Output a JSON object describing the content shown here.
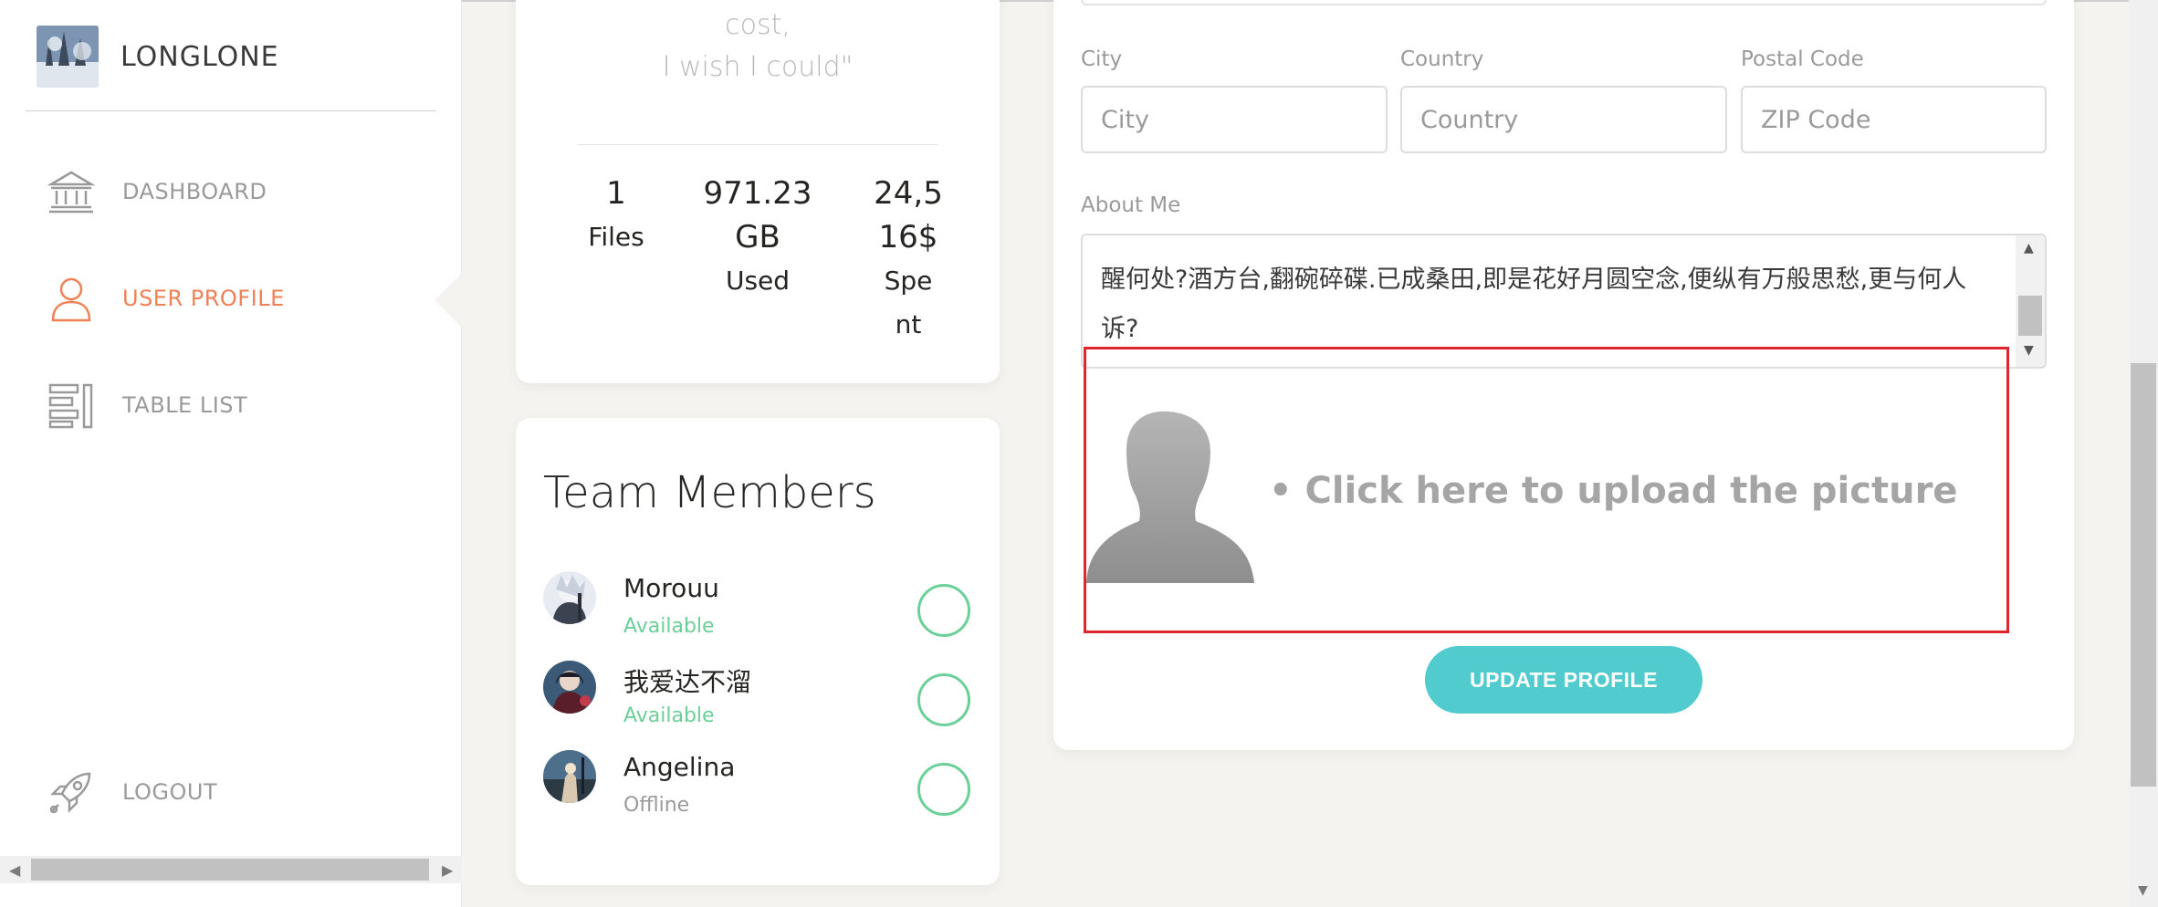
{
  "brand": {
    "name": "LONGLONE"
  },
  "sidebar": {
    "items": [
      {
        "label": "DASHBOARD",
        "icon": "bank-icon"
      },
      {
        "label": "USER PROFILE",
        "icon": "user-icon",
        "active": true
      },
      {
        "label": "TABLE LIST",
        "icon": "list-icon"
      }
    ],
    "logout": {
      "label": "LOGOUT",
      "icon": "rocket-icon"
    }
  },
  "profile": {
    "quote_line1": "cost,",
    "quote_line2": "I wish I could\"",
    "stats": [
      {
        "value": "1",
        "unit": "Files"
      },
      {
        "value_line1": "971.23",
        "value_line2": "GB",
        "unit": "Used"
      },
      {
        "value_line1": "24,5",
        "value_line2": "16$",
        "unit_line1": "Spe",
        "unit_line2": "nt"
      }
    ]
  },
  "team": {
    "title": "Team Members",
    "members": [
      {
        "name": "Morouu",
        "status": "Available"
      },
      {
        "name": "我爱达不溜",
        "status": "Available"
      },
      {
        "name": "Angelina",
        "status": "Offline"
      }
    ]
  },
  "form": {
    "city": {
      "label": "City",
      "placeholder": "City"
    },
    "country": {
      "label": "Country",
      "placeholder": "Country"
    },
    "postal": {
      "label": "Postal Code",
      "placeholder": "ZIP Code"
    },
    "about": {
      "label": "About Me",
      "line1": "醒何处?酒方台,翻碗碎碟.已成桑田,即是花好月圆空念,便纵有万般思愁,更与何人",
      "line2": "诉?"
    },
    "upload_text": "• Click here to upload the picture",
    "update_button": "UPDATE PROFILE"
  },
  "colors": {
    "accent": "#ef8157",
    "success": "#6bd098",
    "primary_button": "#51cbce",
    "upload_border": "#e0262c"
  }
}
